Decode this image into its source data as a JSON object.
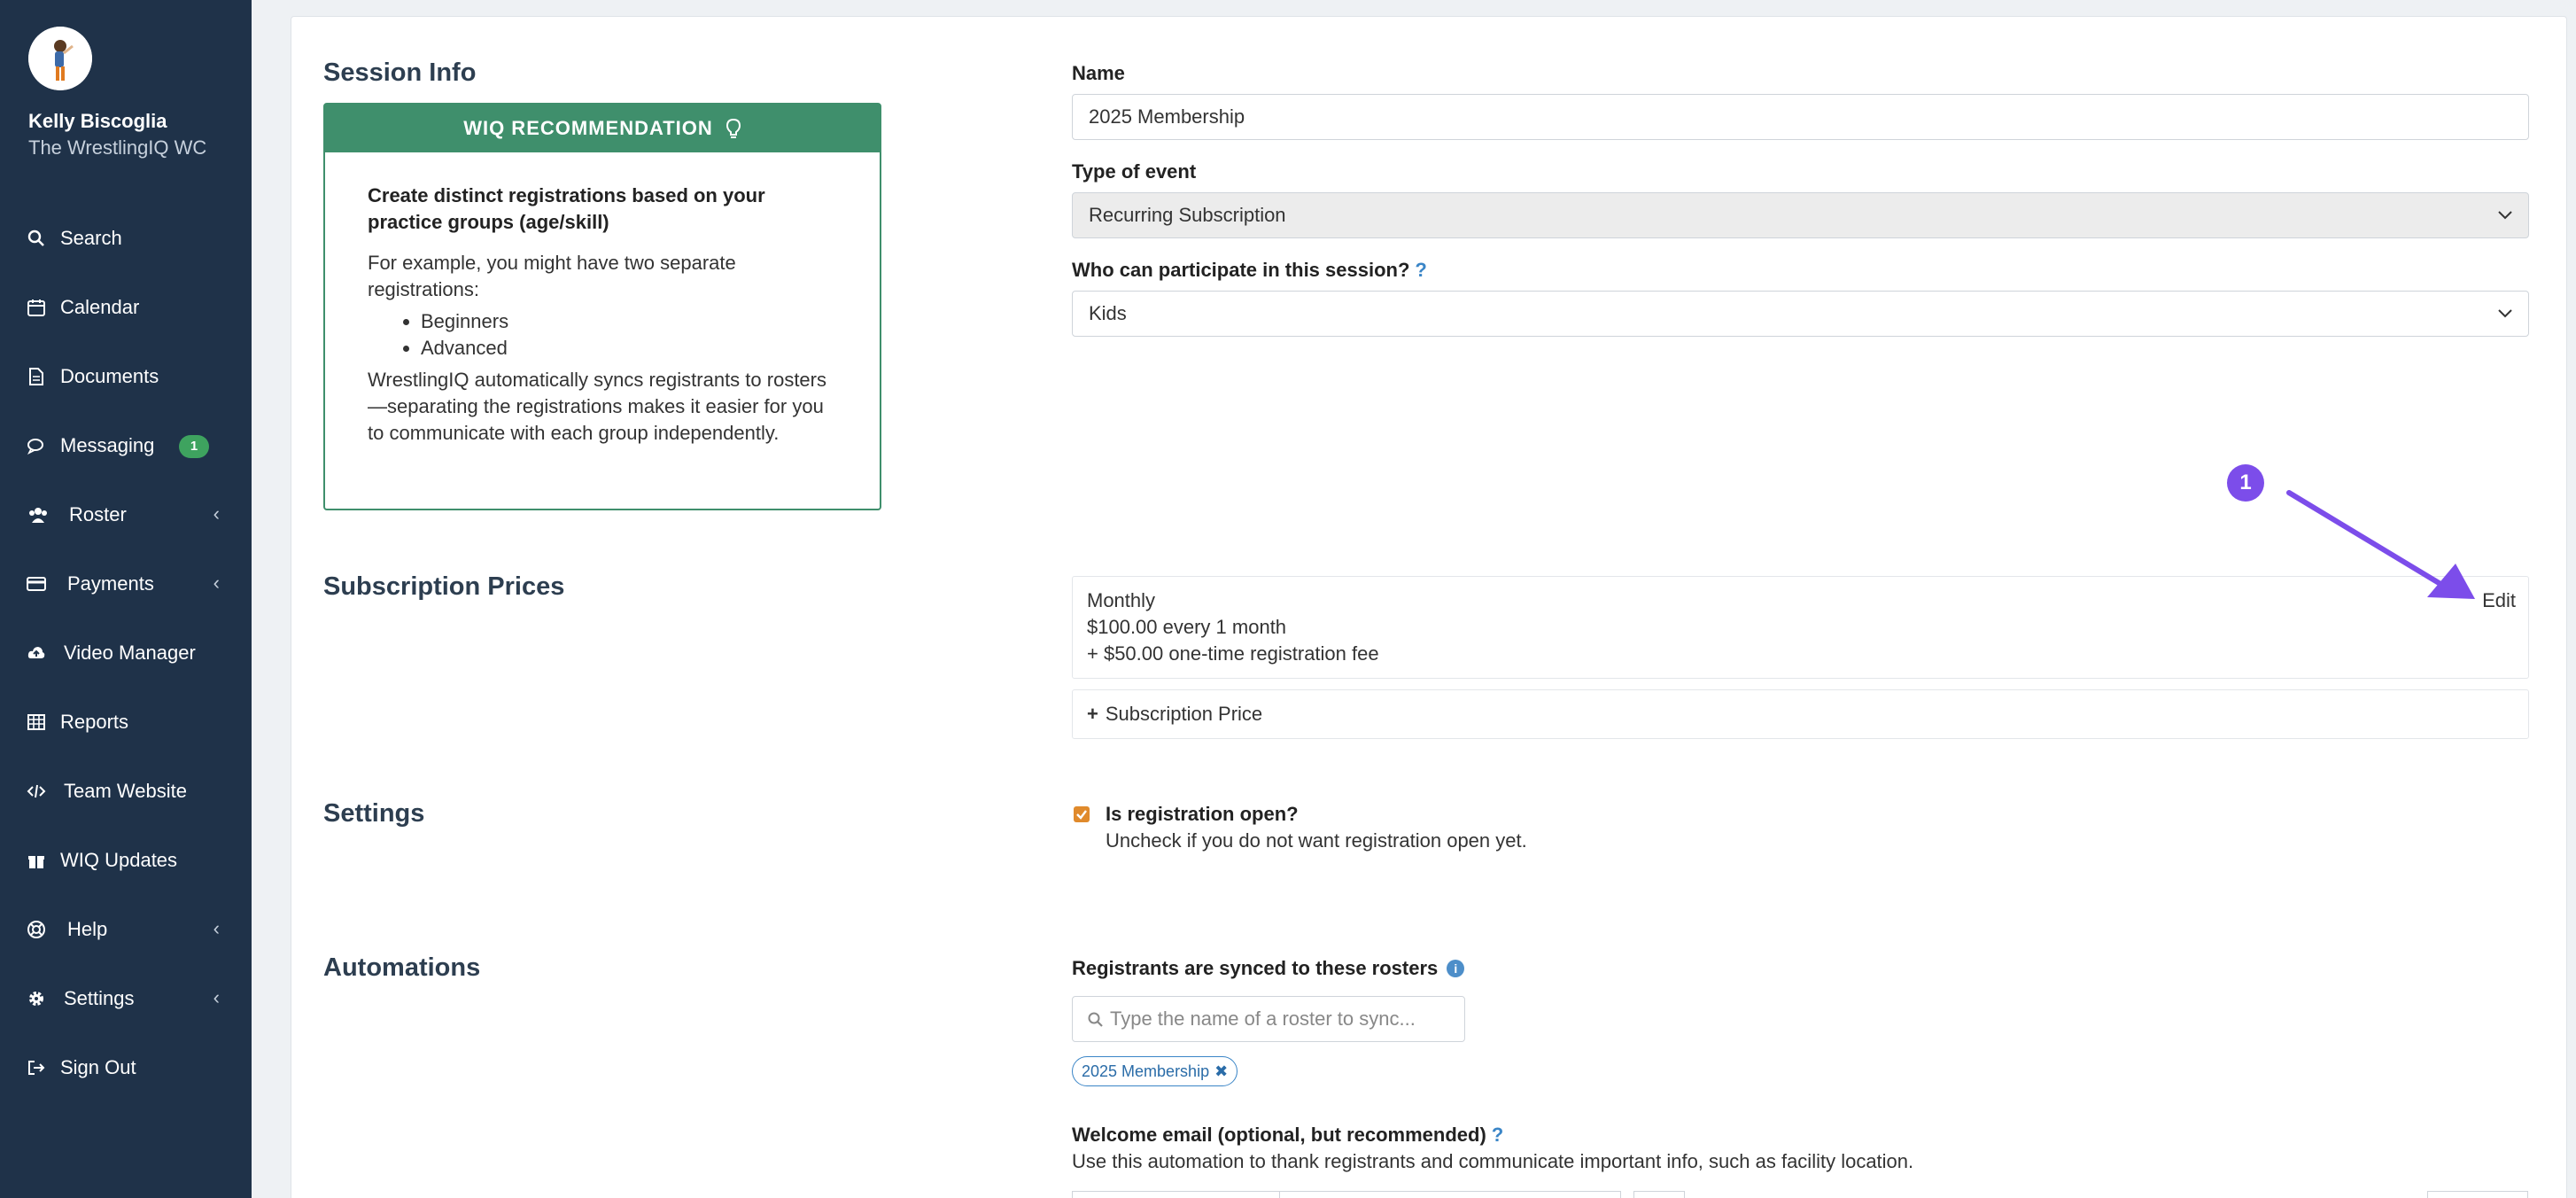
{
  "user": {
    "name": "Kelly Biscoglia",
    "team": "The WrestlingIQ WC"
  },
  "nav": [
    {
      "label": "Search",
      "icon": "search-icon"
    },
    {
      "label": "Calendar",
      "icon": "calendar-icon"
    },
    {
      "label": "Documents",
      "icon": "document-icon"
    },
    {
      "label": "Messaging",
      "icon": "chat-icon",
      "badge": "1"
    },
    {
      "label": "Roster",
      "icon": "users-icon",
      "chevron": "‹"
    },
    {
      "label": "Payments",
      "icon": "credit-card-icon",
      "chevron": "‹"
    },
    {
      "label": "Video Manager",
      "icon": "cloud-upload-icon"
    },
    {
      "label": "Reports",
      "icon": "table-icon"
    },
    {
      "label": "Team Website",
      "icon": "code-icon"
    },
    {
      "label": "WIQ Updates",
      "icon": "gift-icon"
    },
    {
      "label": "Help",
      "icon": "lifebuoy-icon",
      "chevron": "‹"
    },
    {
      "label": "Settings",
      "icon": "gear-icon",
      "chevron": "‹"
    },
    {
      "label": "Sign Out",
      "icon": "sign-out-icon"
    }
  ],
  "sections": {
    "session_info": "Session Info",
    "subscription_prices": "Subscription Prices",
    "settings": "Settings",
    "automations": "Automations"
  },
  "recommendation": {
    "header": "WIQ RECOMMENDATION",
    "headline": "Create distinct registrations based on your practice groups (age/skill)",
    "intro": "For example, you might have two separate registrations:",
    "items": [
      "Beginners",
      "Advanced"
    ],
    "footer": "WrestlingIQ automatically syncs registrants to rosters—separating the registrations makes it easier for you to communicate with each group independently."
  },
  "form": {
    "name_label": "Name",
    "name_value": "2025 Membership",
    "type_label": "Type of event",
    "type_value": "Recurring Subscription",
    "participants_label": "Who can participate in this session?",
    "participants_help": "?",
    "participants_value": "Kids"
  },
  "price": {
    "name": "Monthly",
    "amount": "$100.00 every 1 month",
    "fee": "+ $50.00 one-time registration fee",
    "edit_label": "Edit",
    "add_label": "Subscription Price",
    "add_icon": "+"
  },
  "settings": {
    "registration_open_label": "Is registration open?",
    "registration_open_help": "Uncheck if you do not want registration open yet.",
    "registration_open": true
  },
  "automations": {
    "rosters_label": "Registrants are synced to these rosters",
    "roster_search_placeholder": "Type the name of a roster to sync...",
    "roster_tag": "2025 Membership",
    "welcome_label": "Welcome email (optional, but recommended)",
    "welcome_help_mark": "?",
    "welcome_help": "Use this automation to thank registrants and communicate important info, such as facility location."
  },
  "annotation": {
    "step": "1"
  },
  "colors": {
    "sidebar": "#1f3249",
    "recommendation": "#3f8f6c",
    "annotation": "#7c4dea",
    "badge": "#3ea35f"
  }
}
